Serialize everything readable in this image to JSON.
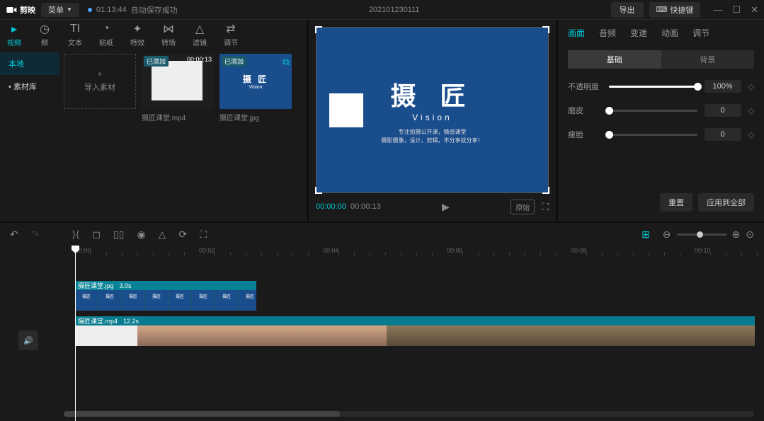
{
  "app": {
    "name": "剪映"
  },
  "titlebar": {
    "menu": "菜单",
    "timestamp": "01:13:44",
    "autosave": "自动保存成功",
    "project": "202101230111",
    "export": "导出",
    "shortcuts": "快捷键"
  },
  "mediaTabs": [
    {
      "label": "视频",
      "icon": "▸"
    },
    {
      "label": "频",
      "icon": "◷"
    },
    {
      "label": "文本",
      "icon": "TI"
    },
    {
      "label": "贴纸",
      "icon": "◔"
    },
    {
      "label": "特效",
      "icon": "✦"
    },
    {
      "label": "转场",
      "icon": "⋈"
    },
    {
      "label": "滤镜",
      "icon": "△"
    },
    {
      "label": "调节",
      "icon": "⇄"
    }
  ],
  "mediaSide": [
    {
      "label": "本地",
      "active": true
    },
    {
      "label": "• 素材库",
      "active": false
    }
  ],
  "importTile": "导入素材",
  "mediaItems": [
    {
      "name": "摄匠课堂.mp4",
      "badge": "已添加",
      "duration": "00:00:13",
      "type": "video"
    },
    {
      "name": "摄匠课堂.jpg",
      "badge": "已添加",
      "type": "vision"
    }
  ],
  "preview": {
    "title": "摄 匠",
    "subtitle": "Vision",
    "desc1": "专注拍摄公开课，情感课堂",
    "desc2": "摄影摄像，设计，剪辑，不分享就分享！",
    "current": "00:00:00",
    "total": "00:00:13",
    "original": "原始"
  },
  "props": {
    "tabs": [
      "画面",
      "音频",
      "变速",
      "动画",
      "调节"
    ],
    "subTabs": [
      "基础",
      "背景"
    ],
    "opacity": {
      "label": "不透明度",
      "value": "100%",
      "pct": 100
    },
    "smooth": {
      "label": "磨皮",
      "value": "0",
      "pct": 0
    },
    "slim": {
      "label": "瘦脸",
      "value": "0",
      "pct": 0
    },
    "reset": "重置",
    "applyAll": "应用到全部"
  },
  "timeline": {
    "ticks": [
      "00:00",
      "00:02",
      "00:04",
      "00:06",
      "00:08",
      "00:10"
    ],
    "track1": {
      "name": "摄匠课堂.jpg",
      "dur": "3.0s"
    },
    "track2": {
      "name": "摄匠课堂.mp4",
      "dur": "12.2s"
    }
  }
}
